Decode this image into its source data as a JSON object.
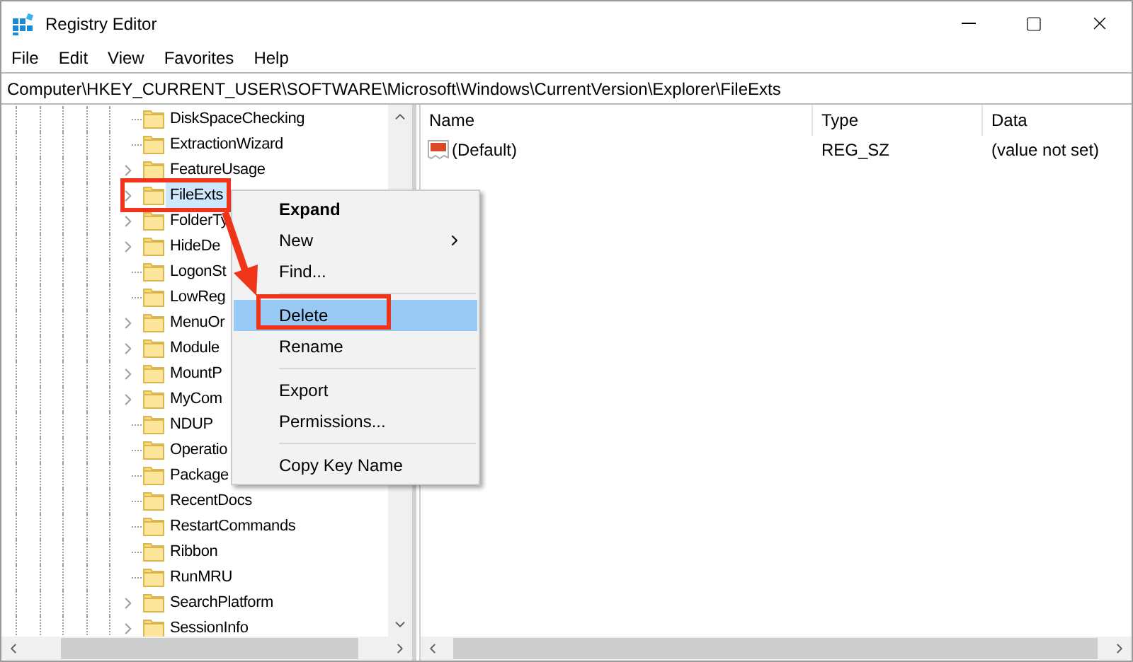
{
  "window": {
    "title": "Registry Editor"
  },
  "menu_bar": [
    "File",
    "Edit",
    "View",
    "Favorites",
    "Help"
  ],
  "address_bar": {
    "value": "Computer\\HKEY_CURRENT_USER\\SOFTWARE\\Microsoft\\Windows\\CurrentVersion\\Explorer\\FileExts"
  },
  "tree": {
    "items": [
      {
        "label": "DiskSpaceChecking",
        "expandable": false,
        "selected": false
      },
      {
        "label": "ExtractionWizard",
        "expandable": false,
        "selected": false
      },
      {
        "label": "FeatureUsage",
        "expandable": true,
        "selected": false
      },
      {
        "label": "FileExts",
        "expandable": true,
        "selected": true
      },
      {
        "label": "FolderTy",
        "expandable": true,
        "selected": false
      },
      {
        "label": "HideDe",
        "expandable": true,
        "selected": false
      },
      {
        "label": "LogonSt",
        "expandable": false,
        "selected": false
      },
      {
        "label": "LowReg",
        "expandable": false,
        "selected": false
      },
      {
        "label": "MenuOr",
        "expandable": true,
        "selected": false
      },
      {
        "label": "Module",
        "expandable": true,
        "selected": false
      },
      {
        "label": "MountP",
        "expandable": true,
        "selected": false
      },
      {
        "label": "MyCom",
        "expandable": true,
        "selected": false
      },
      {
        "label": "NDUP",
        "expandable": false,
        "selected": false
      },
      {
        "label": "Operatio",
        "expandable": false,
        "selected": false
      },
      {
        "label": "Package",
        "expandable": false,
        "selected": false
      },
      {
        "label": "RecentDocs",
        "expandable": false,
        "selected": false
      },
      {
        "label": "RestartCommands",
        "expandable": false,
        "selected": false
      },
      {
        "label": "Ribbon",
        "expandable": false,
        "selected": false
      },
      {
        "label": "RunMRU",
        "expandable": false,
        "selected": false
      },
      {
        "label": "SearchPlatform",
        "expandable": true,
        "selected": false
      },
      {
        "label": "SessionInfo",
        "expandable": true,
        "selected": false
      }
    ]
  },
  "values_table": {
    "columns": [
      "Name",
      "Type",
      "Data"
    ],
    "rows": [
      {
        "name": "(Default)",
        "type": "REG_SZ",
        "data": "(value not set)"
      }
    ]
  },
  "context_menu": {
    "items": [
      {
        "kind": "item",
        "label": "Expand",
        "bold": true,
        "submenu": false,
        "selected": false
      },
      {
        "kind": "item",
        "label": "New",
        "bold": false,
        "submenu": true,
        "selected": false
      },
      {
        "kind": "item",
        "label": "Find...",
        "bold": false,
        "submenu": false,
        "selected": false
      },
      {
        "kind": "separator"
      },
      {
        "kind": "item",
        "label": "Delete",
        "bold": false,
        "submenu": false,
        "selected": true
      },
      {
        "kind": "item",
        "label": "Rename",
        "bold": false,
        "submenu": false,
        "selected": false
      },
      {
        "kind": "separator"
      },
      {
        "kind": "item",
        "label": "Export",
        "bold": false,
        "submenu": false,
        "selected": false
      },
      {
        "kind": "item",
        "label": "Permissions...",
        "bold": false,
        "submenu": false,
        "selected": false
      },
      {
        "kind": "separator"
      },
      {
        "kind": "item",
        "label": "Copy Key Name",
        "bold": false,
        "submenu": false,
        "selected": false
      }
    ]
  }
}
